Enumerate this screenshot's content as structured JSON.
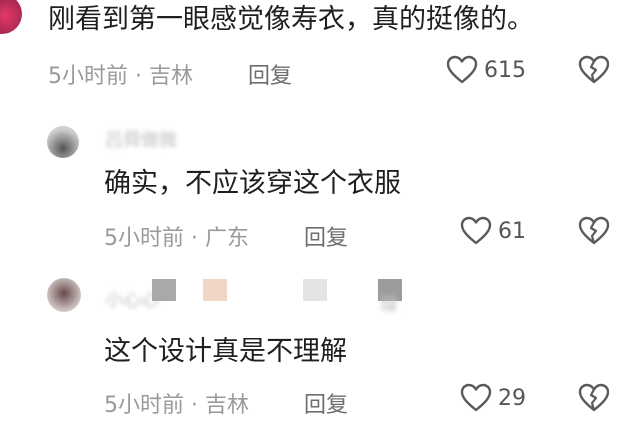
{
  "comments": [
    {
      "text": "刚看到第一眼感觉像寿衣，真的挺像的。",
      "time": "5小时前",
      "location": "吉林",
      "reply_label": "回复",
      "likes": "615"
    },
    {
      "username": "吕舜做微",
      "text": "确实，不应该穿这个衣服",
      "time": "5小时前",
      "location": "广东",
      "reply_label": "回复",
      "likes": "61"
    },
    {
      "username": "小心心",
      "username_tail": "璇",
      "text": "这个设计真是不理解",
      "time": "5小时前",
      "location": "吉林",
      "reply_label": "回复",
      "likes": "29"
    }
  ],
  "separator": "·",
  "icons": {
    "like": "heart-outline-icon",
    "dislike": "broken-heart-icon"
  },
  "colors": {
    "text": "#1f1f1f",
    "meta": "#9a9a9a",
    "reply": "#6e6e6e",
    "icon": "#5a5a5a"
  }
}
